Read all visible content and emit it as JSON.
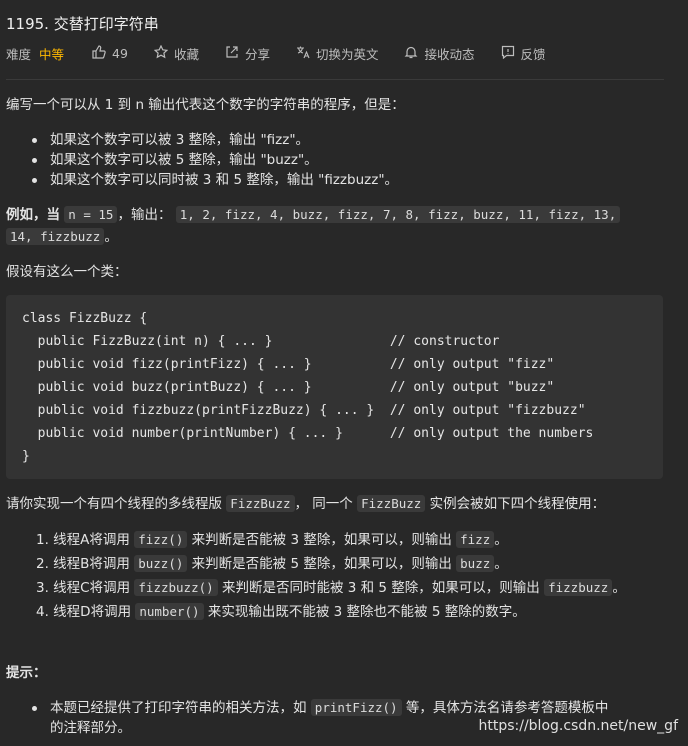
{
  "problem": {
    "title": "1195. 交替打印字符串",
    "difficulty_label": "难度",
    "difficulty": "中等",
    "likes": "49",
    "favorite_label": "收藏",
    "share_label": "分享",
    "switch_lang_label": "切换为英文",
    "subscribe_label": "接收动态",
    "feedback_label": "反馈"
  },
  "description": {
    "intro": "编写一个可以从 1 到 n 输出代表这个数字的字符串的程序，但是：",
    "rules": [
      "如果这个数字可以被 3 整除，输出 \"fizz\"。",
      "如果这个数字可以被 5 整除，输出 \"buzz\"。",
      "如果这个数字可以同时被 3 和 5 整除，输出 \"fizzbuzz\"。"
    ],
    "example_prefix": "例如，当",
    "example_n": "n = 15",
    "example_mid": "，输出：",
    "example_output_1": "1, 2, fizz, 4, buzz, fizz, 7, 8, fizz, buzz, 11, fizz, 13,",
    "example_output_2": "14, fizzbuzz",
    "example_end": "。",
    "class_intro": "假设有这么一个类：",
    "code": "class FizzBuzz {\n  public FizzBuzz(int n) { ... }               // constructor\n  public void fizz(printFizz) { ... }          // only output \"fizz\"\n  public void buzz(printBuzz) { ... }          // only output \"buzz\"\n  public void fizzbuzz(printFizzBuzz) { ... }  // only output \"fizzbuzz\"\n  public void number(printNumber) { ... }      // only output the numbers\n}",
    "impl_prefix": "请你实现一个有四个线程的多线程版 ",
    "impl_class": "FizzBuzz",
    "impl_mid": "， 同一个 ",
    "impl_class2": "FizzBuzz",
    "impl_suffix": " 实例会被如下四个线程使用：",
    "threads": [
      {
        "pre": "1. 线程A将调用 ",
        "code": "fizz()",
        "mid": " 来判断是否能被 3 整除，如果可以，则输出 ",
        "code2": "fizz",
        "end": "。"
      },
      {
        "pre": "2. 线程B将调用 ",
        "code": "buzz()",
        "mid": " 来判断是否能被 5 整除，如果可以，则输出 ",
        "code2": "buzz",
        "end": "。"
      },
      {
        "pre": "3. 线程C将调用 ",
        "code": "fizzbuzz()",
        "mid": " 来判断是否同时能被 3 和 5 整除，如果可以，则输出 ",
        "code2": "fizzbuzz",
        "end": "。"
      },
      {
        "pre": "4. 线程D将调用 ",
        "code": "number()",
        "mid": " 来实现输出既不能被 3 整除也不能被 5 整除的数字。"
      }
    ],
    "hint_title": "提示：",
    "hint_pre": "本题已经提供了打印字符串的相关方法，如 ",
    "hint_code": "printFizz()",
    "hint_post": " 等，具体方法名请参考答题模板中",
    "hint_line2": "的注释部分。"
  },
  "watermark": "https://blog.csdn.net/new_gf"
}
